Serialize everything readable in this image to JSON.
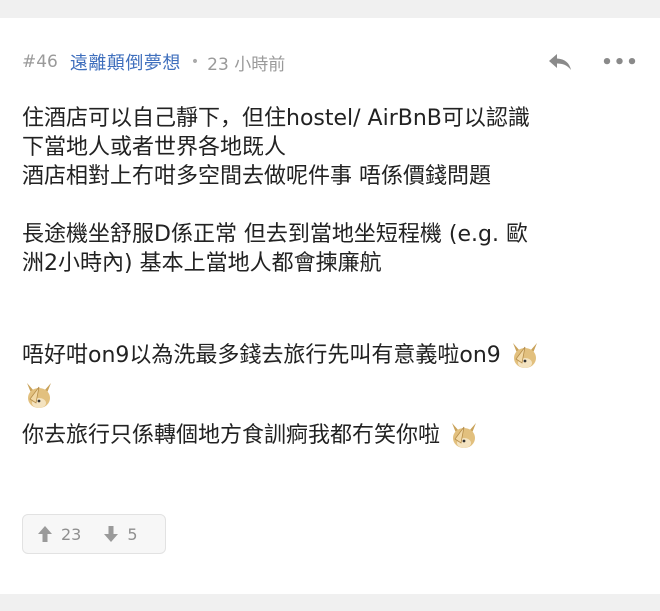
{
  "post": {
    "number": "#46",
    "author": "遠離顛倒夢想",
    "separator": "•",
    "time": "23 小時前",
    "paragraphs": {
      "p1": {
        "l1": "住酒店可以自己靜下，但住hostel/ AirBnB可以認識",
        "l2": "下當地人或者世界各地既人",
        "l3": "酒店相對上冇咁多空間去做呢件事 唔係價錢問題"
      },
      "p2": {
        "l1": "長途機坐舒服D係正常 但去到當地坐短程機 (e.g. 歐",
        "l2": "洲2小時內) 基本上當地人都會揀廉航"
      },
      "p3": {
        "l1": "唔好咁on9以為洗最多錢去旅行先叫有意義啦on9",
        "l3": "你去旅行只係轉個地方食訓痾我都冇笑你啦"
      }
    },
    "emoji_icon": "facepalm-dog-emoji",
    "upvotes": "23",
    "downvotes": "5"
  },
  "colors": {
    "author": "#3f6fbd",
    "meta": "#9a9a9a",
    "text": "#222222",
    "background": "#f0f0f0"
  }
}
